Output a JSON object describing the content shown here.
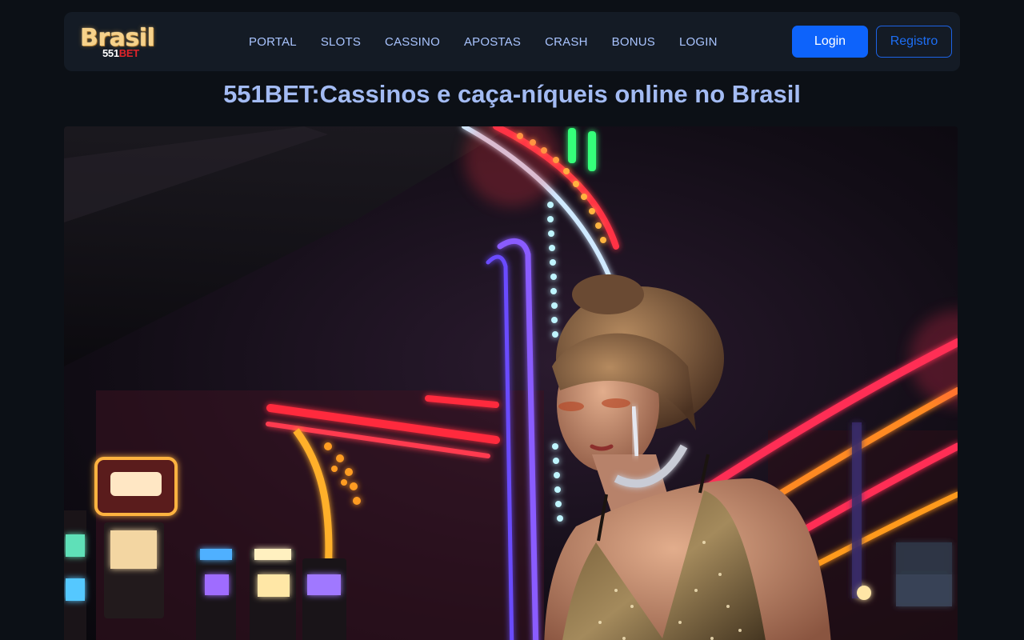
{
  "header": {
    "logo": {
      "word": "Brasil",
      "sub_number": "551",
      "sub_brand": "BET"
    },
    "nav": [
      "PORTAL",
      "SLOTS",
      "CASSINO",
      "APOSTAS",
      "CRASH",
      "BONUS",
      "LOGIN"
    ],
    "login_button": "Login",
    "register_button": "Registro"
  },
  "main": {
    "title": "551BET:Cassinos e caça-níqueis online no Brasil"
  },
  "colors": {
    "page_bg": "#0c1016",
    "header_bg": "#141b25",
    "nav_link": "#a9c4ff",
    "title": "#a3bbf3",
    "primary_button": "#0d63fb",
    "logo_gold": "#f7d28a",
    "logo_red": "#e0242a"
  }
}
